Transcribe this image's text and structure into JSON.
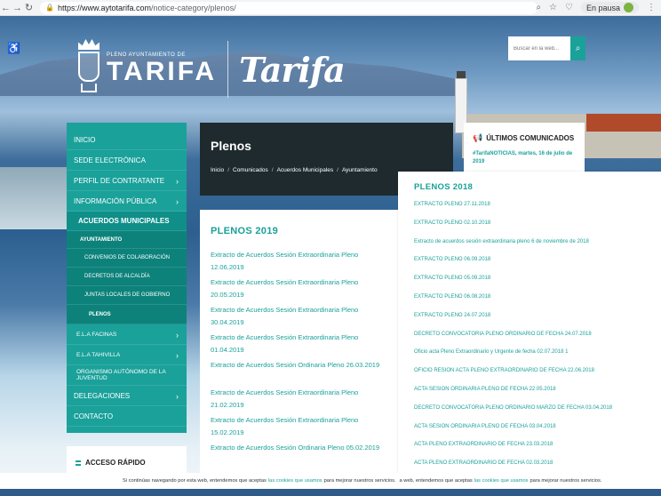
{
  "browser": {
    "url_host": "https://www.aytotarifa.com",
    "url_path": "/notice-category/plenos/",
    "pause_label": "En pausa"
  },
  "header": {
    "logo_small": "PLENO AYUNTAMIENTO DE",
    "logo_big": "TARIFA",
    "logo_script": "Tarifa",
    "search_placeholder": "Buscar en la web..."
  },
  "sidebar": {
    "items": [
      {
        "label": "INICIO"
      },
      {
        "label": "SEDE ELECTRÓNICA"
      },
      {
        "label": "PERFIL DE CONTRATANTE",
        "chev": "›"
      },
      {
        "label": "INFORMACIÓN PÚBLICA",
        "chev": "›"
      },
      {
        "label": "ACUERDOS MUNICIPALES"
      },
      {
        "label": "AYUNTAMIENTO"
      },
      {
        "label": "CONVENIOS DE COLABORACIÓN"
      },
      {
        "label": "DECRETOS DE ALCALDÍA"
      },
      {
        "label": "JUNTAS LOCALES DE GOBIERNO"
      },
      {
        "label": "PLENOS"
      },
      {
        "label": "E.L.A FACINAS",
        "chev": "›"
      },
      {
        "label": "E.L.A TAHIVILLA",
        "chev": "›"
      },
      {
        "label": "ORGANISMO AUTÓNOMO DE LA JUVENTUD"
      },
      {
        "label": "DELEGACIONES",
        "chev": "›"
      },
      {
        "label": "CONTACTO"
      }
    ],
    "quick_access": "ACCESO RÁPIDO"
  },
  "title_block": {
    "title": "Plenos",
    "breadcrumb": [
      "Inicio",
      "Comunicados",
      "Acuerdos Municipales",
      "Ayuntamiento"
    ],
    "separator": "/"
  },
  "news": {
    "heading": "ÚLTIMOS COMUNICADOS",
    "item": "#TarifaNOTICIAS, martes, 16 de julio de 2019"
  },
  "main": {
    "heading": "PLENOS 2019",
    "links": [
      "Extracto de Acuerdos Sesión Extraordinaria Pleno 12.06.2019",
      "Extracto de Acuerdos Sesión Extraordinaria Pleno 20.05.2019",
      "Extracto de Acuerdos Sesión Extraordinaria Pleno 30.04.2019",
      "Extracto de Acuerdos Sesión Extraordinaria Pleno 01.04.2019",
      "Extracto de Acuerdos Sesión Ordinaria Pleno 26.03.2019",
      "Extracto de Acuerdos Sesión Extraordinaria Pleno 21.02.2019",
      "Extracto de Acuerdos Sesión Extraordinaria Pleno 15.02.2019",
      "Extracto de Acuerdos Sesión Ordinaria Pleno 05.02.2019"
    ]
  },
  "panel": {
    "heading": "PLENOS 2018",
    "links": [
      "EXTRACTO PLENO 27.11.2018",
      "EXTRACTO PLENO 02.10.2018",
      "Extracto de acuerdos sesión extraordinaria pleno 6 de noviembre de 2018",
      "EXTRACTO PLENO 06.09.2018",
      "EXTRACTO PLENO 05.09.2018",
      "EXTRACTO PLENO 06.08.2018",
      "EXTRACTO PLENO 24.07.2018",
      "DECRETO CONVOCATORIA PLENO ORDINARIO DE FECHA 24.07.2018",
      "Oficio acta Pleno Extraordinario y Urgente de fecha 02.07.2018 1",
      "OFICIO RESION ACTA PLENO EXTRAORDINARIO DE FECHA 22.06.2018",
      "ACTA SESION ORDINARIA PLENO DE FECHA 22.05.2018",
      "DECRETO CONVOCATORIA PLENO ORDINARIO MARZO DE FECHA 03.04.2018",
      "ACTA SESION ORDINARIA PLENO DE FECHA 03.04.2018",
      "ACTA PLENO EXTRAORDINARIO DE FECHA 23.03.2018",
      "ACTA PLENO EXTRAORDINARIO DE FECHA 02.03.2018"
    ]
  },
  "cookie": {
    "text_before": "Si continúas navegando por esta web, entendemos que aceptas",
    "link": "las cookies que usamos",
    "text_after": "para mejorar nuestros servicios.",
    "text_before_2": "a web, entendemos que aceptas",
    "link_2": "las cookies que usamos",
    "text_after_2": "para mejorar nuestros servicios."
  }
}
